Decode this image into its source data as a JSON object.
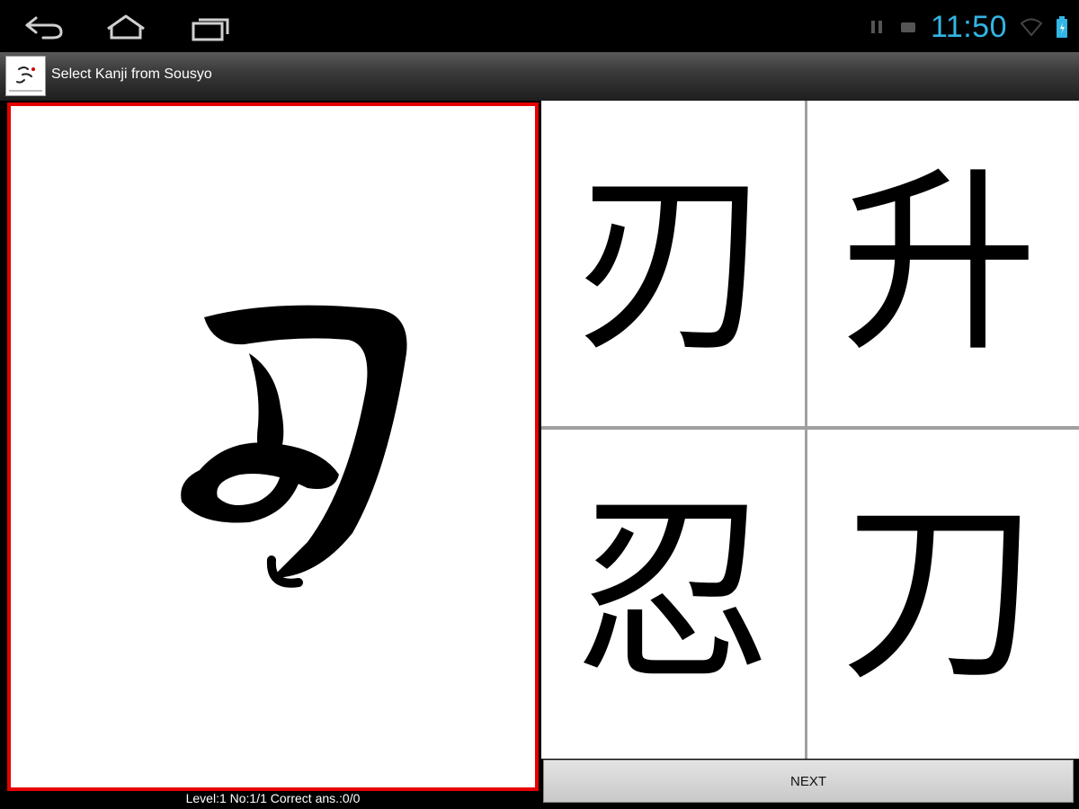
{
  "status_bar": {
    "time": "11:50",
    "clock_color": "#33b5e5",
    "icons": [
      "back-icon",
      "home-icon",
      "recent-apps-icon",
      "pause-icon",
      "notification-icon",
      "wifi-icon",
      "battery-icon"
    ]
  },
  "action_bar": {
    "title": "Select Kanji from Sousyo",
    "icon": "calligraphy-app-icon"
  },
  "question": {
    "kanji_style": "sousyo-cursive",
    "border_color": "#e60000"
  },
  "choices": [
    {
      "glyph": "刃"
    },
    {
      "glyph": "升"
    },
    {
      "glyph": "忍"
    },
    {
      "glyph": "刀"
    }
  ],
  "next_label": "NEXT",
  "progress": {
    "text": "Level:1 No:1/1 Correct ans.:0/0"
  }
}
